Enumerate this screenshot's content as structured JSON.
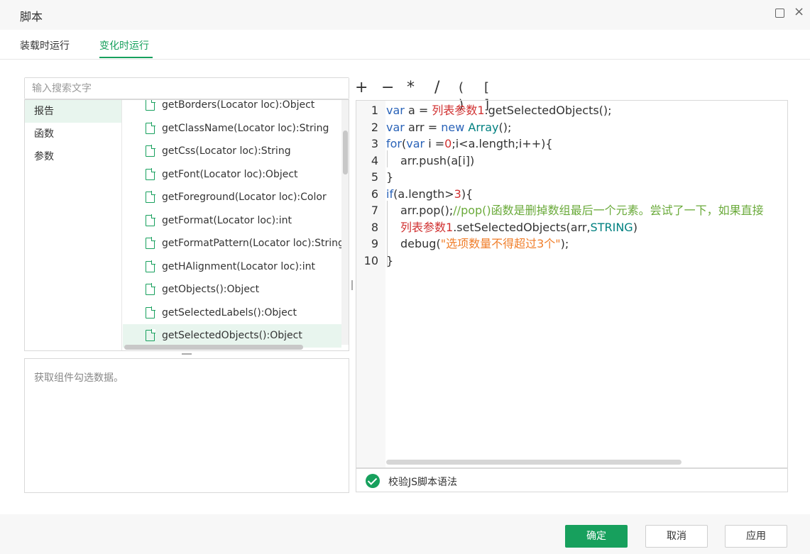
{
  "dialog": {
    "title": "脚本"
  },
  "tabs": [
    {
      "label": "装载时运行"
    },
    {
      "label": "变化时运行"
    }
  ],
  "active_tab": 1,
  "search": {
    "placeholder": "输入搜索文字",
    "value": ""
  },
  "categories": [
    {
      "label": "报告"
    },
    {
      "label": "函数"
    },
    {
      "label": "参数"
    }
  ],
  "functions": [
    {
      "label": "getBorders(Locator loc):Object"
    },
    {
      "label": "getClassName(Locator loc):String"
    },
    {
      "label": "getCss(Locator loc):String"
    },
    {
      "label": "getFont(Locator loc):Object"
    },
    {
      "label": "getForeground(Locator loc):Color"
    },
    {
      "label": "getFormat(Locator loc):int"
    },
    {
      "label": "getFormatPattern(Locator loc):String"
    },
    {
      "label": "getHAlignment(Locator loc):int"
    },
    {
      "label": "getObjects():Object"
    },
    {
      "label": "getSelectedLabels():Object"
    },
    {
      "label": "getSelectedObjects():Object"
    }
  ],
  "description": "获取组件勾选数据。",
  "operators": [
    "+",
    "−",
    "*",
    "/",
    "( )",
    "[ ]"
  ],
  "code": {
    "line_numbers": [
      "1",
      "2",
      "3",
      "4",
      "5",
      "6",
      "7",
      "8",
      "9",
      "10"
    ],
    "l1": {
      "a": "var",
      "b": " a = ",
      "c": "列表参数1",
      "d": ".getSelectedObjects();"
    },
    "l2": {
      "a": "var",
      "b": " arr = ",
      "c": "new",
      "d": " ",
      "e": "Array",
      "f": "();"
    },
    "l3": {
      "a": "for",
      "b": "(",
      "c": "var",
      "d": " i =",
      "e": "0",
      "f": ";i<a.length;i++){"
    },
    "l4": {
      "a": "arr.push(a[i])"
    },
    "l5": {
      "a": "}"
    },
    "l6": {
      "a": "if",
      "b": "(a.length>",
      "c": "3",
      "d": "){"
    },
    "l7": {
      "a": "arr.pop();",
      "b": "//pop()函数是删掉数组最后一个元素。尝试了一下，如果直接"
    },
    "l8": {
      "a": "列表参数1",
      "b": ".setSelectedObjects(arr,",
      "c": "STRING",
      "d": ")"
    },
    "l9": {
      "a": "debug(",
      "b": "\"选项数量不得超过3个\"",
      "c": ");"
    },
    "l10": {
      "a": "}"
    }
  },
  "validate_label": "校验JS脚本语法",
  "buttons": {
    "ok": "确定",
    "cancel": "取消",
    "apply": "应用"
  },
  "colors": {
    "accent": "#17a05d",
    "keyword": "#2a63b8",
    "identifier": "#d03030",
    "string": "#f07e2a",
    "comment": "#6aaa3a",
    "constant": "#008080"
  },
  "icons": {
    "maximize": "maximize-icon",
    "close": "close-icon",
    "function": "function-doc-icon",
    "check": "check-circle-icon"
  }
}
